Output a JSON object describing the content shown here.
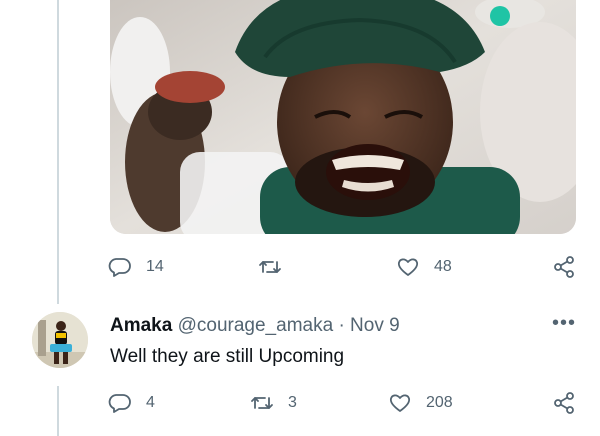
{
  "tweet1": {
    "media_icon": "photo",
    "actions": {
      "reply_count": "14",
      "retweet_count": "",
      "like_count": "48"
    }
  },
  "tweet2": {
    "avatar_icon": "avatar",
    "name": "Amaka",
    "handle": "@courage_amaka",
    "separator": "·",
    "date": "Nov 9",
    "more_label": "•••",
    "text": "Well they are still Upcoming",
    "actions": {
      "reply_count": "4",
      "retweet_count": "3",
      "like_count": "208"
    }
  },
  "icons": {
    "reply": "reply-icon",
    "retweet": "retweet-icon",
    "like": "heart-icon",
    "share": "share-icon"
  },
  "colors": {
    "text_primary": "#0f1419",
    "text_secondary": "#536471",
    "thread_line": "#cfd9de"
  }
}
